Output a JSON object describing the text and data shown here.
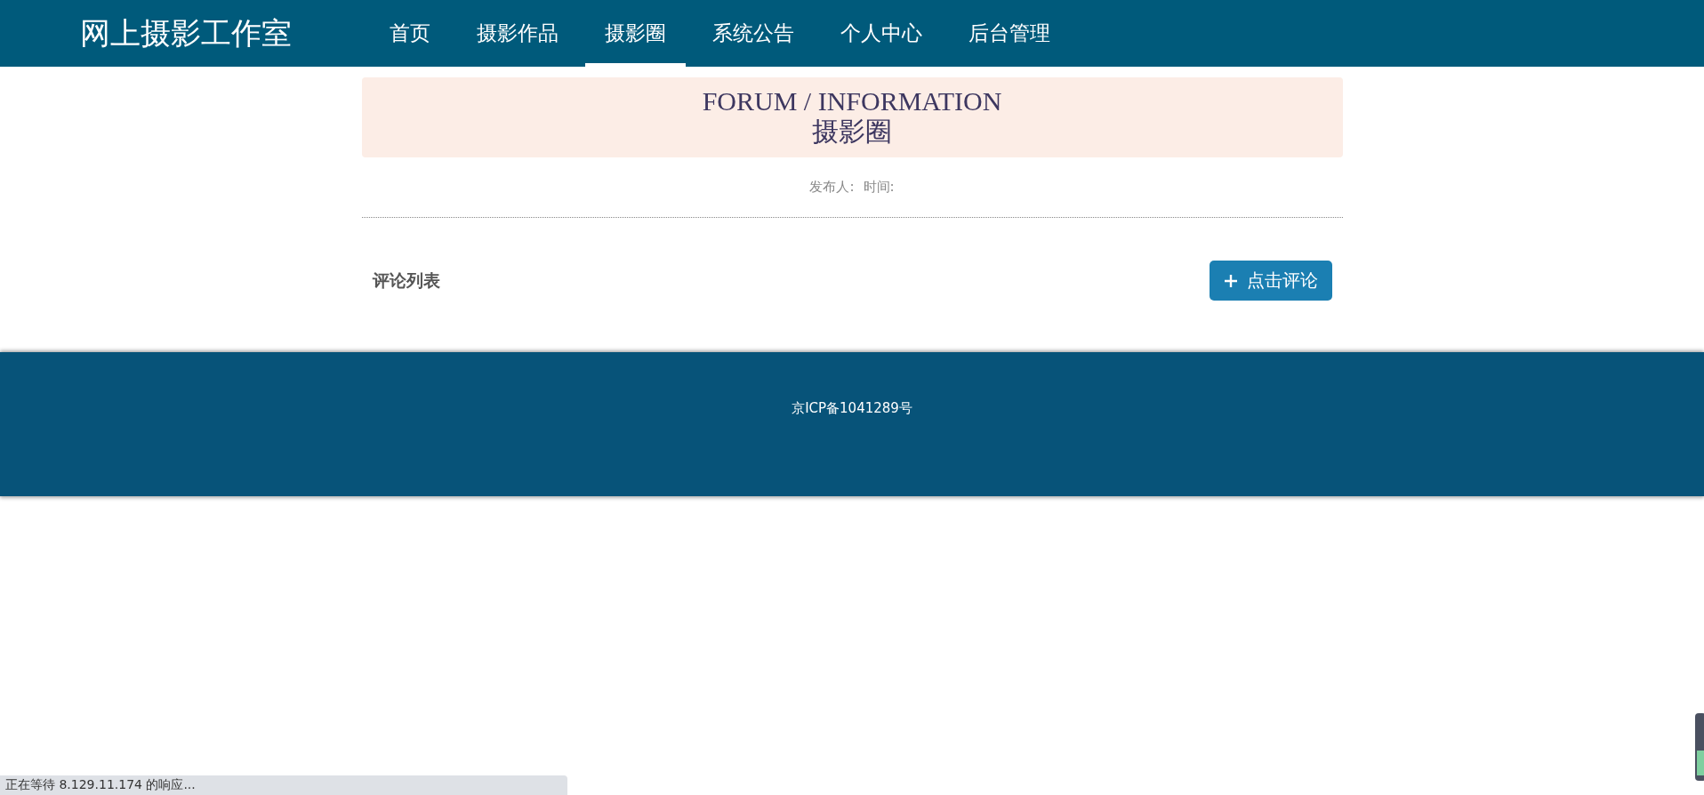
{
  "header": {
    "logo": "网上摄影工作室",
    "nav": [
      {
        "label": "首页",
        "selected": false
      },
      {
        "label": "摄影作品",
        "selected": false
      },
      {
        "label": "摄影圈",
        "selected": true
      },
      {
        "label": "系统公告",
        "selected": false
      },
      {
        "label": "个人中心",
        "selected": false
      },
      {
        "label": "后台管理",
        "selected": false
      }
    ]
  },
  "banner": {
    "title": "FORUM / INFORMATION",
    "subtitle": "摄影圈"
  },
  "meta": {
    "publisher_label": "发布人:",
    "time_label": "时间:"
  },
  "comments": {
    "heading": "评论列表",
    "button": "点击评论"
  },
  "footer": {
    "text": "京ICP备1041289号"
  },
  "status_bar": {
    "text": "正在等待 8.129.11.174 的响应..."
  }
}
